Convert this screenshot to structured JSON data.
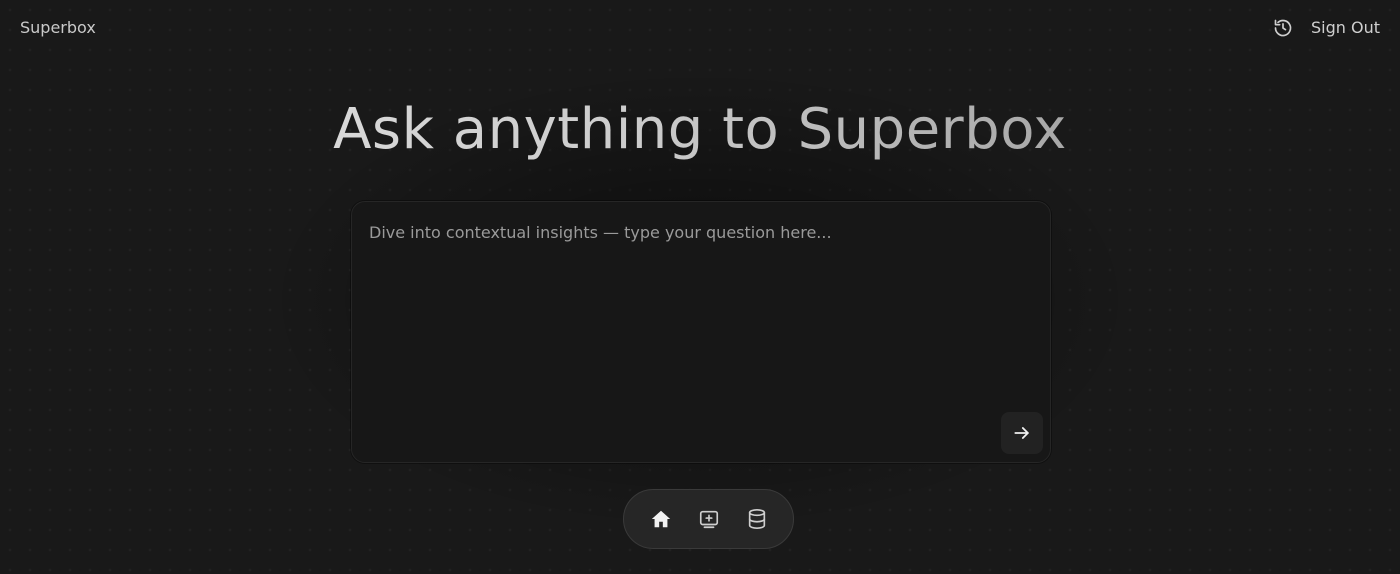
{
  "app": {
    "brand": "Superbox"
  },
  "header": {
    "history_icon": "history-icon",
    "sign_out_label": "Sign Out"
  },
  "main": {
    "headline": "Ask anything to Superbox",
    "query": {
      "placeholder": "Dive into contextual insights — type your question here...",
      "value": "",
      "send_icon": "arrow-right-icon"
    }
  },
  "dock": {
    "items": [
      {
        "icon": "home-icon",
        "active": true
      },
      {
        "icon": "add-source-icon",
        "active": false
      },
      {
        "icon": "database-icon",
        "active": false
      }
    ]
  },
  "colors": {
    "background": "#191919",
    "panel": "#171717",
    "dock": "#262626",
    "text": "#cfcfcf",
    "muted": "#9a9a9a"
  }
}
